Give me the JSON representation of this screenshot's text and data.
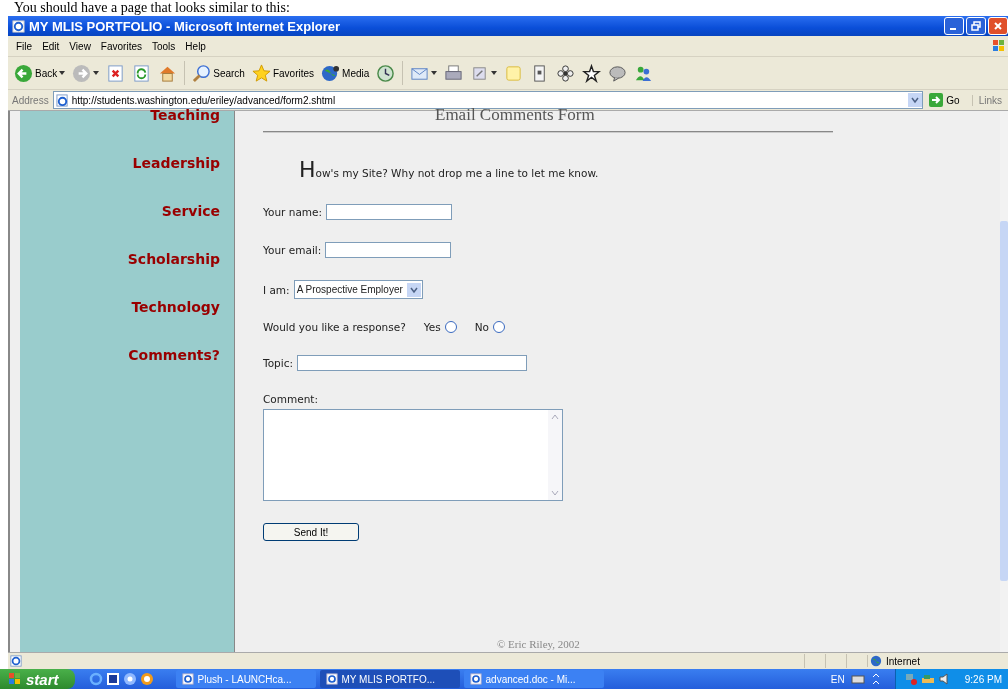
{
  "doc_caption": "You should have a page that looks similar to this:",
  "window": {
    "title": "MY MLIS PORTFOLIO - Microsoft Internet Explorer"
  },
  "menu": [
    "File",
    "Edit",
    "View",
    "Favorites",
    "Tools",
    "Help"
  ],
  "toolbar": [
    {
      "kind": "back",
      "label": "Back"
    },
    {
      "kind": "forward"
    },
    {
      "kind": "stop"
    },
    {
      "kind": "refresh"
    },
    {
      "kind": "home"
    },
    {
      "kind": "search",
      "label": "Search"
    },
    {
      "kind": "favorites",
      "label": "Favorites"
    },
    {
      "kind": "media",
      "label": "Media"
    },
    {
      "kind": "history"
    },
    {
      "kind": "mail"
    },
    {
      "kind": "print"
    },
    {
      "kind": "edit"
    },
    {
      "kind": "note"
    },
    {
      "kind": "device"
    },
    {
      "kind": "flower"
    },
    {
      "kind": "star"
    },
    {
      "kind": "chat"
    },
    {
      "kind": "messenger"
    }
  ],
  "address": {
    "label": "Address",
    "url": "http://students.washington.edu/eriley/advanced/form2.shtml",
    "go": "Go",
    "links": "Links"
  },
  "sidebar": {
    "items": [
      "Teaching",
      "Leadership",
      "Service",
      "Scholarship",
      "Technology",
      "Comments?"
    ]
  },
  "page": {
    "heading": "Email Comments Form",
    "intro_initial": "H",
    "intro_rest": "ow's my Site? Why not drop me a line to let me know."
  },
  "form": {
    "name_label": "Your name:",
    "email_label": "Your email:",
    "iam_label": "I am:",
    "iam_value": "A Prospective Employer",
    "response_question": "Would you like a response?",
    "response_options": [
      {
        "label": "Yes",
        "selected": false
      },
      {
        "label": "No",
        "selected": false
      }
    ],
    "topic_label": "Topic:",
    "comment_label": "Comment:",
    "submit": "Send It!"
  },
  "footer": "© Eric Riley, 2002",
  "status_bar": {
    "zone": "Internet"
  },
  "taskbar": {
    "start": "start",
    "tasks": [
      {
        "label": "Plush - LAUNCHca...",
        "selected": false
      },
      {
        "label": "MY MLIS PORTFO...",
        "selected": true
      },
      {
        "label": "advanced.doc - Mi...",
        "selected": false
      }
    ],
    "language": "EN",
    "clock": "9:26 PM"
  }
}
